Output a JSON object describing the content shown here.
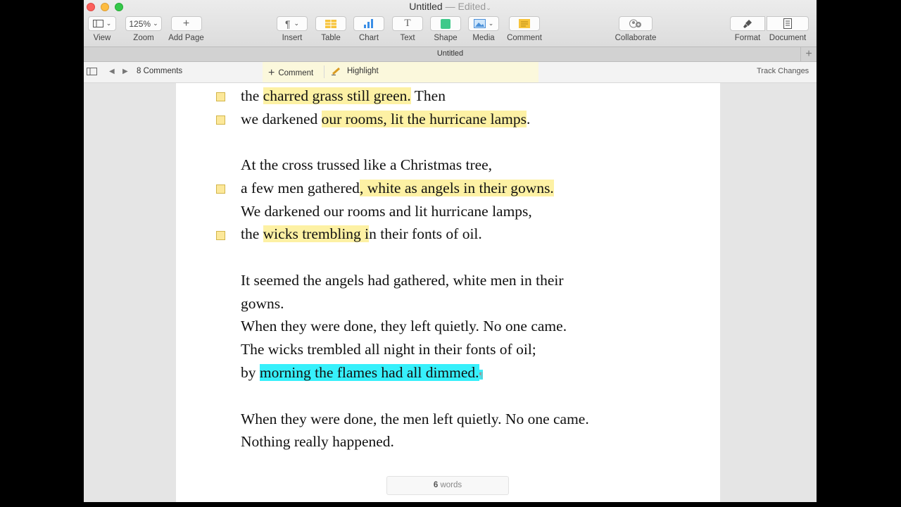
{
  "window": {
    "title": "Untitled",
    "edited": " — Edited"
  },
  "toolbar": {
    "zoom_value": "125%",
    "items": [
      {
        "label": "View",
        "icon": "sidebar-icon"
      },
      {
        "label": "Zoom"
      },
      {
        "label": "Add Page",
        "icon": "plus-icon"
      },
      {
        "label": "Insert",
        "icon": "paragraph-icon"
      },
      {
        "label": "Table",
        "icon": "table-icon"
      },
      {
        "label": "Chart",
        "icon": "chart-icon"
      },
      {
        "label": "Text",
        "icon": "text-icon"
      },
      {
        "label": "Shape",
        "icon": "shape-icon"
      },
      {
        "label": "Media",
        "icon": "media-icon"
      },
      {
        "label": "Comment",
        "icon": "comment-icon"
      },
      {
        "label": "Collaborate",
        "icon": "collaborate-icon"
      },
      {
        "label": "Format",
        "icon": "format-brush-icon"
      },
      {
        "label": "Document",
        "icon": "document-icon"
      }
    ]
  },
  "tabbar": {
    "title": "Untitled"
  },
  "comments_bar": {
    "count_label": "8 Comments",
    "comment_label": "Comment",
    "highlight_label": "Highlight",
    "track_changes_label": "Track Changes"
  },
  "document": {
    "lines": [
      [
        "the ",
        "charred grass still green.",
        " Then"
      ],
      [
        "we darkened ",
        "our rooms, lit the hurricane lamps",
        "."
      ],
      [
        "At the cross trussed like a Christmas tree,"
      ],
      [
        "a few men gathered",
        ", white as angels in their gowns."
      ],
      [
        "We darkened our rooms and lit hurricane lamps,"
      ],
      [
        "the ",
        "wicks trembling i",
        "n their fonts of oil."
      ],
      [
        "It seemed the angels had gathered, white men in their"
      ],
      [
        "gowns."
      ],
      [
        "When they were done, they left quietly. No one came."
      ],
      [
        "The wicks trembled all night in their fonts of oil;"
      ],
      [
        "by ",
        "morning the flames had all dimmed.",
        "¶"
      ],
      [
        "When they were done, the men left quietly. No one came."
      ],
      [
        "Nothing really happened."
      ]
    ],
    "highlight_color": "#fdf1a4",
    "selection_color": "#37f0fb"
  },
  "word_count": {
    "number": "6",
    "label": " words"
  }
}
